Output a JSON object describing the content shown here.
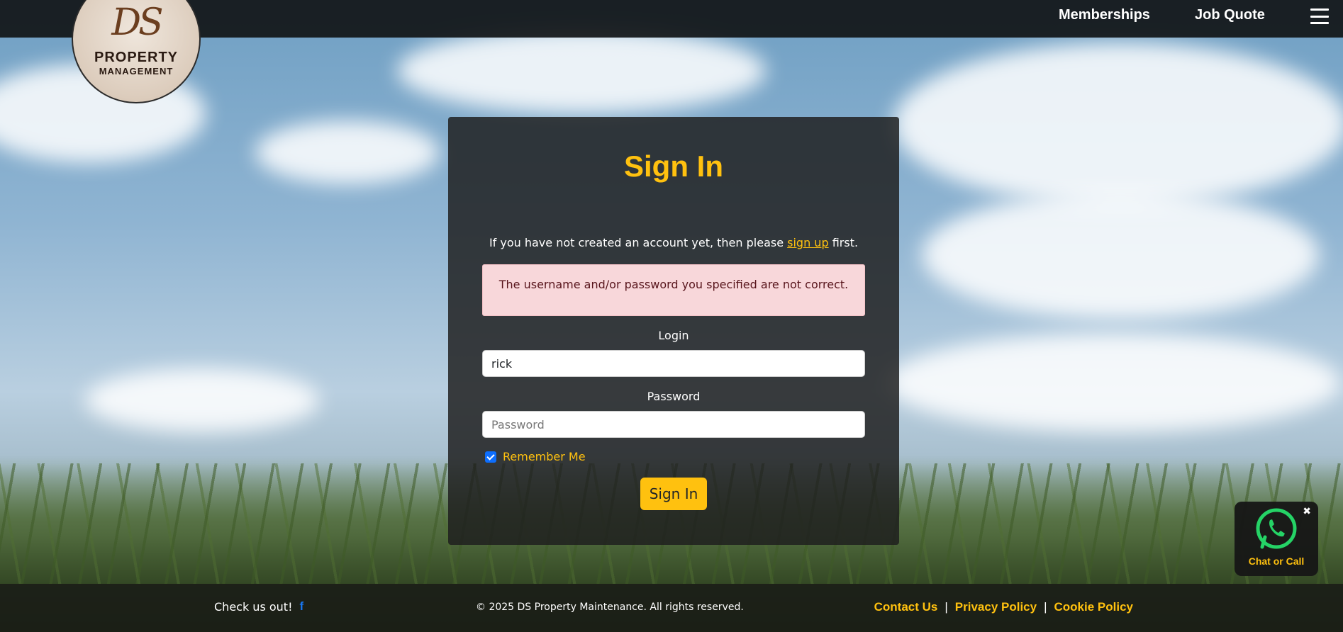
{
  "nav": {
    "links": [
      "Memberships",
      "Job Quote"
    ],
    "menu_icon": "hamburger-menu-icon"
  },
  "logo": {
    "mark": "DS",
    "line1": "PROPERTY",
    "line2": "MANAGEMENT"
  },
  "signin": {
    "title": "Sign In",
    "intro_before": "If you have not created an account yet, then please ",
    "intro_link": "sign up",
    "intro_after": " first.",
    "error": "The username and/or password you specified are not correct.",
    "login_label": "Login",
    "login_value": "rick",
    "password_label": "Password",
    "password_placeholder": "Password",
    "remember_label": "Remember Me",
    "remember_checked": true,
    "button": "Sign In"
  },
  "chat": {
    "label": "Chat or Call",
    "close": "✖",
    "icon": "whatsapp-icon"
  },
  "footer": {
    "check_us": "Check us out!",
    "social_icon": "f",
    "copyright": "© 2025 DS Property Maintenance. All rights reserved.",
    "links": [
      "Contact Us",
      "Privacy Policy",
      "Cookie Policy"
    ],
    "separator": "|"
  },
  "colors": {
    "accent": "#ffc10f",
    "alert_bg": "#f8d7da",
    "checkbox": "#0d6efd",
    "whatsapp": "#25d366"
  }
}
